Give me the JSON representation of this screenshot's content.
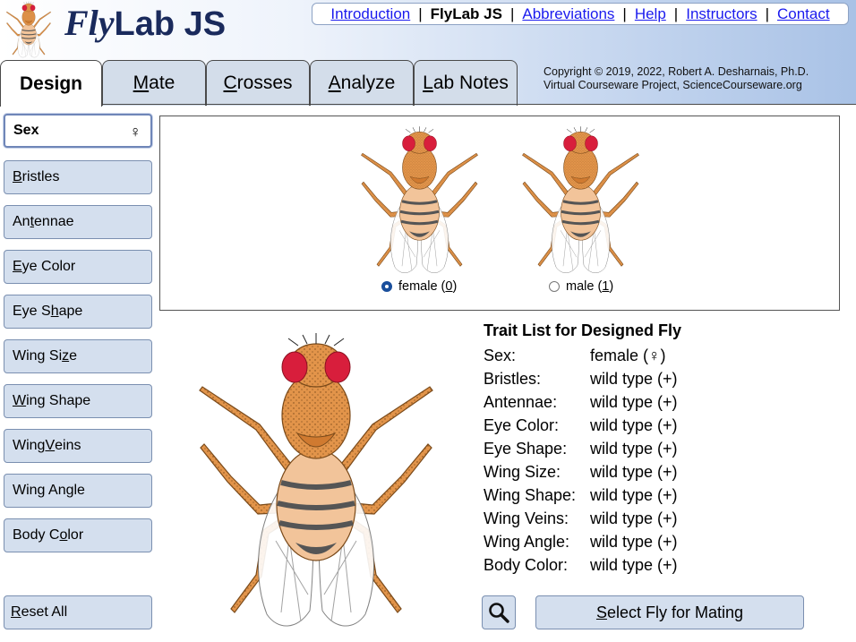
{
  "header": {
    "logo_fly": "Fly",
    "logo_rest": "Lab JS",
    "copyright_line1": "Copyright © 2019, 2022, Robert A. Desharnais, Ph.D.",
    "copyright_line2": "Virtual Courseware Project, ScienceCourseware.org"
  },
  "topnav": {
    "items": [
      {
        "label": "Introduction",
        "current": false
      },
      {
        "label": "FlyLab JS",
        "current": true
      },
      {
        "label": "Abbreviations",
        "current": false
      },
      {
        "label": "Help",
        "current": false
      },
      {
        "label": "Instructors",
        "current": false
      },
      {
        "label": "Contact",
        "current": false
      }
    ],
    "separator": "|"
  },
  "tabs": [
    {
      "label": "Design",
      "hotkey": "",
      "rest": "Design",
      "active": true
    },
    {
      "label": "Mate",
      "hotkey": "M",
      "rest": "ate",
      "active": false
    },
    {
      "label": "Crosses",
      "hotkey": "C",
      "rest": "rosses",
      "active": false
    },
    {
      "label": "Analyze",
      "hotkey": "A",
      "rest": "nalyze",
      "active": false
    },
    {
      "label": "Lab Notes",
      "hotkey": "L",
      "rest": "ab Notes",
      "active": false
    }
  ],
  "sidebar": {
    "items": [
      {
        "pre": "Sex",
        "key": "",
        "post": "",
        "symbol": "♀",
        "selected": true
      },
      {
        "pre": "",
        "key": "B",
        "post": "ristles",
        "selected": false
      },
      {
        "pre": "An",
        "key": "t",
        "post": "ennae",
        "selected": false
      },
      {
        "pre": "",
        "key": "E",
        "post": "ye Color",
        "selected": false
      },
      {
        "pre": "Eye S",
        "key": "h",
        "post": "ape",
        "selected": false
      },
      {
        "pre": "Wing Si",
        "key": "z",
        "post": "e",
        "selected": false
      },
      {
        "pre": "",
        "key": "W",
        "post": "ing Shape",
        "selected": false
      },
      {
        "pre": "Wing ",
        "key": "V",
        "post": "eins",
        "selected": false
      },
      {
        "pre": "Wing An",
        "key": "g",
        "post": "le",
        "selected": false
      },
      {
        "pre": "Body C",
        "key": "o",
        "post": "lor",
        "selected": false
      }
    ],
    "reset": {
      "key": "R",
      "post": "eset All"
    }
  },
  "chooser": {
    "options": [
      {
        "label": "female (",
        "key": "0",
        "close": ")",
        "checked": true
      },
      {
        "label": "male (",
        "key": "1",
        "close": ")",
        "checked": false
      }
    ]
  },
  "traits": {
    "title": "Trait List for Designed Fly",
    "rows": [
      {
        "name": "Sex:",
        "value": "female (♀)"
      },
      {
        "name": "Bristles:",
        "value": "wild type (+)"
      },
      {
        "name": "Antennae:",
        "value": "wild type (+)"
      },
      {
        "name": "Eye Color:",
        "value": "wild type (+)"
      },
      {
        "name": "Eye Shape:",
        "value": "wild type (+)"
      },
      {
        "name": "Wing Size:",
        "value": "wild type (+)"
      },
      {
        "name": "Wing Shape:",
        "value": "wild type (+)"
      },
      {
        "name": "Wing Veins:",
        "value": "wild type (+)"
      },
      {
        "name": "Wing Angle:",
        "value": "wild type (+)"
      },
      {
        "name": "Body Color:",
        "value": "wild type (+)"
      }
    ]
  },
  "buttons": {
    "zoom_icon": "magnifier-icon",
    "select_key": "S",
    "select_post": "elect Fly for Mating"
  },
  "colors": {
    "body": "#e2944a",
    "eye": "#d81e3c",
    "abdomen": "#f2c49a",
    "stripe": "#555555",
    "button_bg": "#d4dfee",
    "link": "#1a1aee",
    "title": "#1a2a5c"
  }
}
